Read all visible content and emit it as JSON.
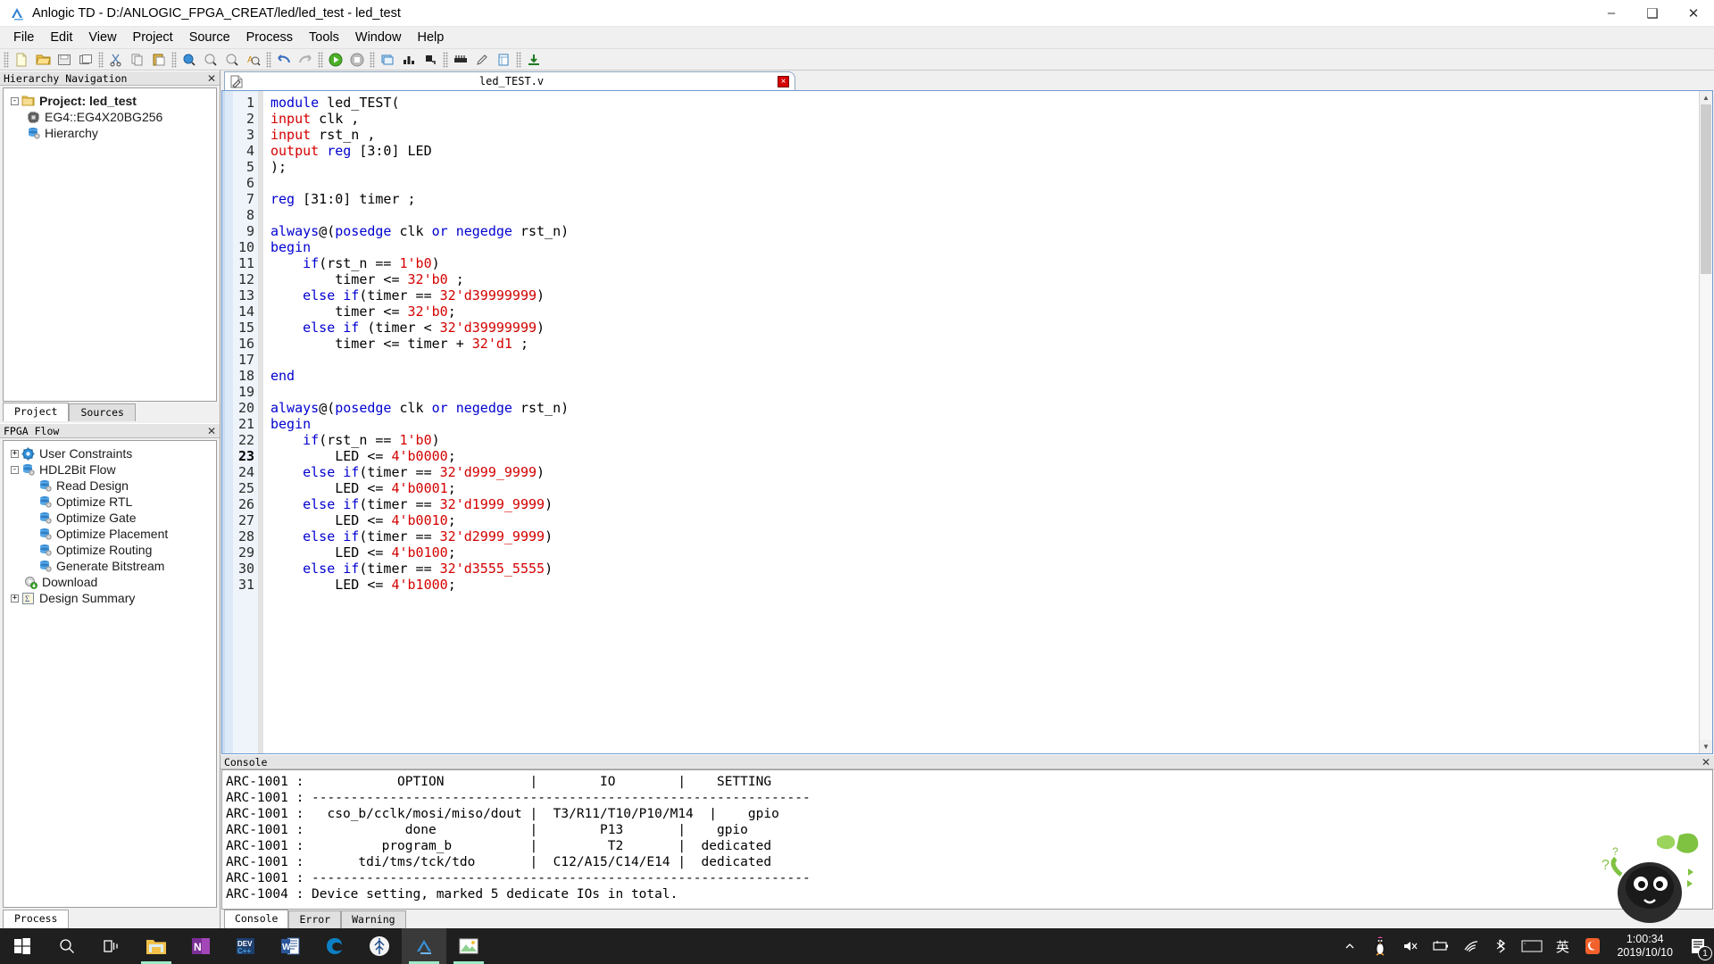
{
  "window": {
    "title": "Anlogic TD - D:/ANLOGIC_FPGA_CREAT/led/led_test - led_test",
    "app_icon": "anlogic-logo-icon",
    "minimize": "–",
    "maximize": "❑",
    "close": "✕"
  },
  "menubar": {
    "items": [
      "File",
      "Edit",
      "View",
      "Project",
      "Source",
      "Process",
      "Tools",
      "Window",
      "Help"
    ]
  },
  "toolbar": {
    "groups": [
      [
        "new-file-icon",
        "open-folder-icon",
        "save-icon",
        "save-all-icon"
      ],
      [
        "cut-icon",
        "copy-icon",
        "paste-icon"
      ],
      [
        "zoom-in-icon",
        "zoom-out-icon",
        "zoom-fit-icon",
        "find-text-icon"
      ],
      [
        "undo-icon",
        "redo-icon"
      ],
      [
        "run-icon",
        "stop-icon"
      ],
      [
        "report-icon",
        "chart-icon",
        "timing-icon"
      ],
      [
        "device-icon",
        "pencil-icon",
        "constraint-icon"
      ],
      [
        "download-icon"
      ]
    ]
  },
  "hierarchy_panel": {
    "title": "Hierarchy Navigation",
    "close_glyph": "✕",
    "tree": [
      {
        "label": "Project: led_test",
        "icon": "folder-icon",
        "expander": "-",
        "depth": 0,
        "bold": true
      },
      {
        "label": "EG4::EG4X20BG256",
        "icon": "chip-icon",
        "expander": "",
        "depth": 1,
        "bold": false
      },
      {
        "label": "Hierarchy",
        "icon": "database-gear-icon",
        "expander": "",
        "depth": 1,
        "bold": false
      }
    ],
    "tabs": [
      {
        "label": "Project",
        "active": true
      },
      {
        "label": "Sources",
        "active": false
      }
    ]
  },
  "fpga_flow_panel": {
    "title": "FPGA Flow",
    "close_glyph": "✕",
    "tree": [
      {
        "label": "User Constraints",
        "icon": "gear-blue-icon",
        "expander": "+",
        "depth": 0
      },
      {
        "label": "HDL2Bit Flow",
        "icon": "database-gear-icon",
        "expander": "-",
        "depth": 0
      },
      {
        "label": "Read Design",
        "icon": "database-gear-icon",
        "expander": "",
        "depth": 1
      },
      {
        "label": "Optimize RTL",
        "icon": "database-gear-icon",
        "expander": "",
        "depth": 1
      },
      {
        "label": "Optimize Gate",
        "icon": "database-gear-icon",
        "expander": "",
        "depth": 1
      },
      {
        "label": "Optimize Placement",
        "icon": "database-gear-icon",
        "expander": "",
        "depth": 1
      },
      {
        "label": "Optimize Routing",
        "icon": "database-gear-icon",
        "expander": "",
        "depth": 1
      },
      {
        "label": "Generate Bitstream",
        "icon": "database-gear-icon",
        "expander": "",
        "depth": 1
      },
      {
        "label": "Download",
        "icon": "download-gear-icon",
        "expander": "",
        "depth": 0
      },
      {
        "label": "Design Summary",
        "icon": "sigma-icon",
        "expander": "+",
        "depth": 0
      }
    ],
    "bottom_tab": "Process"
  },
  "editor": {
    "tab": {
      "name": "led_TEST.v",
      "icon": "verilog-file-icon",
      "close_glyph": "×"
    },
    "current_line": 23,
    "first_line": 1,
    "lines": [
      {
        "n": 1,
        "tokens": [
          {
            "t": "module ",
            "c": "kw"
          },
          {
            "t": "led_TEST(",
            "c": ""
          }
        ]
      },
      {
        "n": 2,
        "tokens": [
          {
            "t": "input",
            "c": "num"
          },
          {
            "t": " clk ,",
            "c": ""
          }
        ]
      },
      {
        "n": 3,
        "tokens": [
          {
            "t": "input",
            "c": "num"
          },
          {
            "t": " rst_n ,",
            "c": ""
          }
        ]
      },
      {
        "n": 4,
        "tokens": [
          {
            "t": "output ",
            "c": "num"
          },
          {
            "t": "reg",
            "c": "kw"
          },
          {
            "t": " [3:0] LED",
            "c": ""
          }
        ]
      },
      {
        "n": 5,
        "tokens": [
          {
            "t": ");",
            "c": ""
          }
        ]
      },
      {
        "n": 6,
        "tokens": [
          {
            "t": "",
            "c": ""
          }
        ]
      },
      {
        "n": 7,
        "tokens": [
          {
            "t": "reg",
            "c": "kw"
          },
          {
            "t": " [31:0] timer ;",
            "c": ""
          }
        ]
      },
      {
        "n": 8,
        "tokens": [
          {
            "t": "",
            "c": ""
          }
        ]
      },
      {
        "n": 9,
        "tokens": [
          {
            "t": "always",
            "c": "kw"
          },
          {
            "t": "@(",
            "c": ""
          },
          {
            "t": "posedge",
            "c": "kw"
          },
          {
            "t": " clk ",
            "c": ""
          },
          {
            "t": "or",
            "c": "kw"
          },
          {
            "t": " ",
            "c": ""
          },
          {
            "t": "negedge",
            "c": "kw"
          },
          {
            "t": " rst_n)",
            "c": ""
          }
        ]
      },
      {
        "n": 10,
        "tokens": [
          {
            "t": "begin",
            "c": "kw"
          }
        ]
      },
      {
        "n": 11,
        "tokens": [
          {
            "t": "    ",
            "c": ""
          },
          {
            "t": "if",
            "c": "kw"
          },
          {
            "t": "(rst_n == ",
            "c": ""
          },
          {
            "t": "1'b0",
            "c": "num"
          },
          {
            "t": ")",
            "c": ""
          }
        ]
      },
      {
        "n": 12,
        "tokens": [
          {
            "t": "        timer <= ",
            "c": ""
          },
          {
            "t": "32'b0",
            "c": "num"
          },
          {
            "t": " ;",
            "c": ""
          }
        ]
      },
      {
        "n": 13,
        "tokens": [
          {
            "t": "    ",
            "c": ""
          },
          {
            "t": "else if",
            "c": "kw"
          },
          {
            "t": "(timer == ",
            "c": ""
          },
          {
            "t": "32'd39999999",
            "c": "num"
          },
          {
            "t": ")",
            "c": ""
          }
        ]
      },
      {
        "n": 14,
        "tokens": [
          {
            "t": "        timer <= ",
            "c": ""
          },
          {
            "t": "32'b0",
            "c": "num"
          },
          {
            "t": ";",
            "c": ""
          }
        ]
      },
      {
        "n": 15,
        "tokens": [
          {
            "t": "    ",
            "c": ""
          },
          {
            "t": "else if",
            "c": "kw"
          },
          {
            "t": " (timer < ",
            "c": ""
          },
          {
            "t": "32'd39999999",
            "c": "num"
          },
          {
            "t": ")",
            "c": ""
          }
        ]
      },
      {
        "n": 16,
        "tokens": [
          {
            "t": "        timer <= timer + ",
            "c": ""
          },
          {
            "t": "32'd1",
            "c": "num"
          },
          {
            "t": " ;",
            "c": ""
          }
        ]
      },
      {
        "n": 17,
        "tokens": [
          {
            "t": "",
            "c": ""
          }
        ]
      },
      {
        "n": 18,
        "tokens": [
          {
            "t": "end",
            "c": "kw"
          }
        ]
      },
      {
        "n": 19,
        "tokens": [
          {
            "t": "",
            "c": ""
          }
        ]
      },
      {
        "n": 20,
        "tokens": [
          {
            "t": "always",
            "c": "kw"
          },
          {
            "t": "@(",
            "c": ""
          },
          {
            "t": "posedge",
            "c": "kw"
          },
          {
            "t": " clk ",
            "c": ""
          },
          {
            "t": "or",
            "c": "kw"
          },
          {
            "t": " ",
            "c": ""
          },
          {
            "t": "negedge",
            "c": "kw"
          },
          {
            "t": " rst_n)",
            "c": ""
          }
        ]
      },
      {
        "n": 21,
        "tokens": [
          {
            "t": "begin",
            "c": "kw"
          }
        ]
      },
      {
        "n": 22,
        "tokens": [
          {
            "t": "    ",
            "c": ""
          },
          {
            "t": "if",
            "c": "kw"
          },
          {
            "t": "(rst_n == ",
            "c": ""
          },
          {
            "t": "1'b0",
            "c": "num"
          },
          {
            "t": ")",
            "c": ""
          }
        ]
      },
      {
        "n": 23,
        "tokens": [
          {
            "t": "        LED <= ",
            "c": ""
          },
          {
            "t": "4'b0000",
            "c": "num"
          },
          {
            "t": ";",
            "c": ""
          }
        ]
      },
      {
        "n": 24,
        "tokens": [
          {
            "t": "    ",
            "c": ""
          },
          {
            "t": "else if",
            "c": "kw"
          },
          {
            "t": "(timer == ",
            "c": ""
          },
          {
            "t": "32'd999_9999",
            "c": "num"
          },
          {
            "t": ")",
            "c": ""
          }
        ]
      },
      {
        "n": 25,
        "tokens": [
          {
            "t": "        LED <= ",
            "c": ""
          },
          {
            "t": "4'b0001",
            "c": "num"
          },
          {
            "t": ";",
            "c": ""
          }
        ]
      },
      {
        "n": 26,
        "tokens": [
          {
            "t": "    ",
            "c": ""
          },
          {
            "t": "else if",
            "c": "kw"
          },
          {
            "t": "(timer == ",
            "c": ""
          },
          {
            "t": "32'd1999_9999",
            "c": "num"
          },
          {
            "t": ")",
            "c": ""
          }
        ]
      },
      {
        "n": 27,
        "tokens": [
          {
            "t": "        LED <= ",
            "c": ""
          },
          {
            "t": "4'b0010",
            "c": "num"
          },
          {
            "t": ";",
            "c": ""
          }
        ]
      },
      {
        "n": 28,
        "tokens": [
          {
            "t": "    ",
            "c": ""
          },
          {
            "t": "else if",
            "c": "kw"
          },
          {
            "t": "(timer == ",
            "c": ""
          },
          {
            "t": "32'd2999_9999",
            "c": "num"
          },
          {
            "t": ")",
            "c": ""
          }
        ]
      },
      {
        "n": 29,
        "tokens": [
          {
            "t": "        LED <= ",
            "c": ""
          },
          {
            "t": "4'b0100",
            "c": "num"
          },
          {
            "t": ";",
            "c": ""
          }
        ]
      },
      {
        "n": 30,
        "tokens": [
          {
            "t": "    ",
            "c": ""
          },
          {
            "t": "else if",
            "c": "kw"
          },
          {
            "t": "(timer == ",
            "c": ""
          },
          {
            "t": "32'd3555_5555",
            "c": "num"
          },
          {
            "t": ")",
            "c": ""
          }
        ]
      },
      {
        "n": 31,
        "tokens": [
          {
            "t": "        LED <= ",
            "c": ""
          },
          {
            "t": "4'b1000",
            "c": "num"
          },
          {
            "t": ";",
            "c": ""
          }
        ]
      }
    ]
  },
  "console": {
    "title": "Console",
    "close_glyph": "✕",
    "lines": [
      "ARC-1001 :            OPTION           |        IO        |    SETTING",
      "ARC-1001 : ----------------------------------------------------------------",
      "ARC-1001 :   cso_b/cclk/mosi/miso/dout |  T3/R11/T10/P10/M14  |    gpio",
      "ARC-1001 :             done            |        P13       |    gpio",
      "ARC-1001 :          program_b          |         T2       |  dedicated",
      "ARC-1001 :       tdi/tms/tck/tdo       |  C12/A15/C14/E14 |  dedicated",
      "ARC-1001 : ----------------------------------------------------------------",
      "ARC-1004 : Device setting, marked 5 dedicate IOs in total."
    ],
    "tabs": [
      {
        "label": "Console",
        "active": true
      },
      {
        "label": "Error",
        "active": false
      },
      {
        "label": "Warning",
        "active": false
      }
    ]
  },
  "taskbar": {
    "apps": [
      {
        "name": "start-button-icon",
        "running": false,
        "active": false
      },
      {
        "name": "search-icon",
        "running": false,
        "active": false
      },
      {
        "name": "task-view-icon",
        "running": false,
        "active": false
      },
      {
        "name": "file-explorer-icon",
        "running": true,
        "active": false
      },
      {
        "name": "onenote-icon",
        "running": false,
        "active": false
      },
      {
        "name": "dev-cpp-icon",
        "running": false,
        "active": false
      },
      {
        "name": "word-icon",
        "running": false,
        "active": false
      },
      {
        "name": "edge-icon",
        "running": false,
        "active": false
      },
      {
        "name": "quartus-icon",
        "running": false,
        "active": false
      },
      {
        "name": "anlogic-td-icon",
        "running": true,
        "active": true
      },
      {
        "name": "photos-icon",
        "running": true,
        "active": false
      }
    ],
    "tray": [
      "show-hidden-icons-chevron",
      "penguin-icon",
      "volume-muted-icon",
      "battery-icon",
      "wifi-icon",
      "bluetooth-icon",
      "touch-keyboard-icon",
      "ime-language-icon",
      "sogou-input-icon"
    ],
    "language_glyph": "英",
    "clock": {
      "time": "1:00:34",
      "date": "2019/10/10"
    },
    "notifications": {
      "count": "1",
      "icon": "action-center-icon"
    }
  },
  "colors": {
    "keyword": "#0000d0",
    "literal": "#d40000",
    "accent": "#6f9bd1",
    "panel": "#f0f0f0",
    "taskbar": "#1f1f1f"
  }
}
